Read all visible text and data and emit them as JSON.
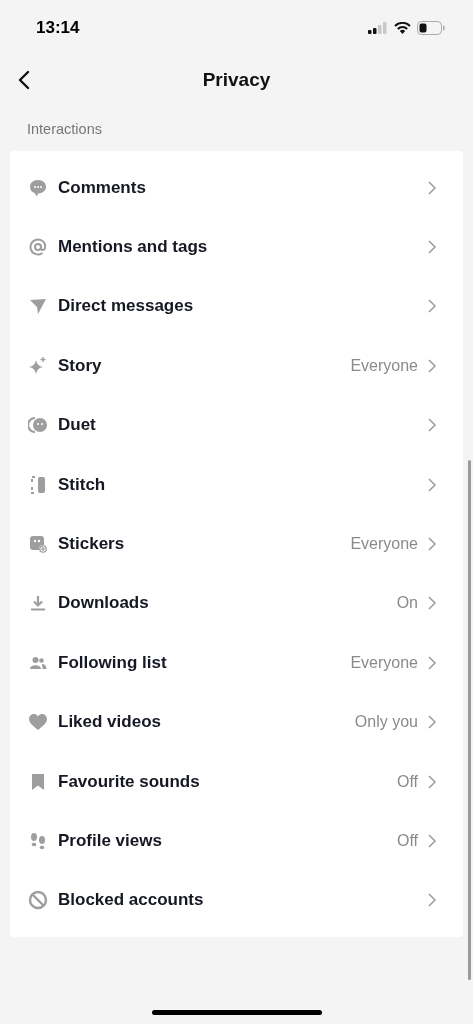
{
  "status_bar": {
    "time": "13:14"
  },
  "header": {
    "title": "Privacy"
  },
  "section": {
    "title": "Interactions"
  },
  "items": [
    {
      "kind": "comment",
      "label": "Comments"
    },
    {
      "kind": "at",
      "label": "Mentions and tags"
    },
    {
      "kind": "send",
      "label": "Direct messages"
    },
    {
      "kind": "sparkle",
      "label": "Story",
      "value": "Everyone"
    },
    {
      "kind": "duet",
      "label": "Duet"
    },
    {
      "kind": "stitch",
      "label": "Stitch"
    },
    {
      "kind": "sticker",
      "label": "Stickers",
      "value": "Everyone"
    },
    {
      "kind": "download",
      "label": "Downloads",
      "value": "On"
    },
    {
      "kind": "people",
      "label": "Following list",
      "value": "Everyone"
    },
    {
      "kind": "heart",
      "label": "Liked videos",
      "value": "Only you"
    },
    {
      "kind": "bookmark",
      "label": "Favourite sounds",
      "value": "Off"
    },
    {
      "kind": "footprints",
      "label": "Profile views",
      "value": "Off"
    },
    {
      "kind": "blocked",
      "label": "Blocked accounts"
    }
  ]
}
